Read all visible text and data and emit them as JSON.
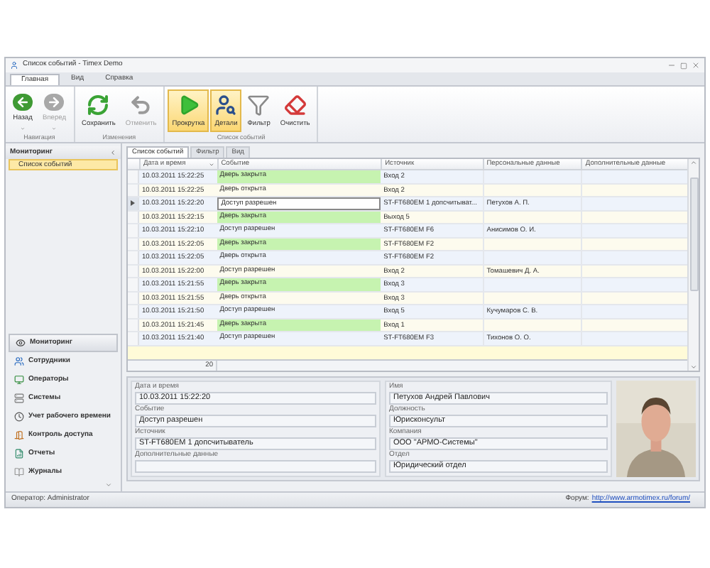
{
  "window": {
    "title": "Список событий - Timex Demo"
  },
  "ribbon_tabs": [
    {
      "label": "Главная",
      "selected": true
    },
    {
      "label": "Вид",
      "selected": false
    },
    {
      "label": "Справка",
      "selected": false
    }
  ],
  "ribbon_groups": [
    {
      "label": "Навигация",
      "buttons": [
        {
          "kind": "back",
          "label": "Назад",
          "disabled": false,
          "active": false,
          "dropdown": true
        },
        {
          "kind": "forward",
          "label": "Вперед",
          "disabled": true,
          "active": false,
          "dropdown": true
        }
      ]
    },
    {
      "label": "Изменения",
      "buttons": [
        {
          "kind": "save",
          "label": "Сохранить",
          "disabled": false,
          "active": false,
          "dropdown": false
        },
        {
          "kind": "undo",
          "label": "Отменить",
          "disabled": true,
          "active": false,
          "dropdown": false
        }
      ]
    },
    {
      "label": "Список событий",
      "buttons": [
        {
          "kind": "scroll",
          "label": "Прокрутка",
          "disabled": false,
          "active": true,
          "dropdown": false
        },
        {
          "kind": "details",
          "label": "Детали",
          "disabled": false,
          "active": true,
          "dropdown": false
        },
        {
          "kind": "filter",
          "label": "Фильтр",
          "disabled": false,
          "active": false,
          "dropdown": false
        },
        {
          "kind": "clear",
          "label": "Очистить",
          "disabled": false,
          "active": false,
          "dropdown": false
        }
      ]
    }
  ],
  "sidebar": {
    "title": "Мониторинг",
    "items": [
      {
        "label": "Список событий",
        "selected": true
      }
    ],
    "nav": [
      {
        "kind": "monitoring",
        "label": "Мониторинг",
        "selected": true
      },
      {
        "kind": "employees",
        "label": "Сотрудники",
        "selected": false
      },
      {
        "kind": "operators",
        "label": "Операторы",
        "selected": false
      },
      {
        "kind": "systems",
        "label": "Системы",
        "selected": false
      },
      {
        "kind": "time",
        "label": "Учет рабочего времени",
        "selected": false
      },
      {
        "kind": "access",
        "label": "Контроль доступа",
        "selected": false
      },
      {
        "kind": "reports",
        "label": "Отчеты",
        "selected": false
      },
      {
        "kind": "journals",
        "label": "Журналы",
        "selected": false
      }
    ]
  },
  "content_tabs": [
    {
      "label": "Список событий",
      "selected": true
    },
    {
      "label": "Фильтр",
      "selected": false
    },
    {
      "label": "Вид",
      "selected": false
    }
  ],
  "table": {
    "columns": [
      "Дата и время",
      "Событие",
      "Источник",
      "Персональные данные",
      "Дополнительные данные"
    ],
    "rows": [
      {
        "date": "10.03.2011 15:22:25",
        "event": "Дверь закрыта",
        "source": "Вход 2",
        "highlight": true,
        "selected": false
      },
      {
        "date": "10.03.2011 15:22:25",
        "event": "Дверь открыта",
        "source": "Вход 2",
        "highlight": false,
        "selected": false
      },
      {
        "date": "10.03.2011 15:22:20",
        "event": "Доступ разрешен",
        "source": "ST-FT680EM 1 допсчитыват...",
        "person": "Петухов А. П.",
        "highlight": false,
        "selected": true
      },
      {
        "date": "10.03.2011 15:22:15",
        "event": "Дверь закрыта",
        "source": "Выход 5",
        "highlight": true,
        "selected": false
      },
      {
        "date": "10.03.2011 15:22:10",
        "event": "Доступ разрешен",
        "source": "ST-FT680EM F6",
        "person": "Анисимов О. И.",
        "highlight": false,
        "selected": false
      },
      {
        "date": "10.03.2011 15:22:05",
        "event": "Дверь закрыта",
        "source": "ST-FT680EM F2",
        "highlight": true,
        "selected": false
      },
      {
        "date": "10.03.2011 15:22:05",
        "event": "Дверь открыта",
        "source": "ST-FT680EM F2",
        "highlight": false,
        "selected": false
      },
      {
        "date": "10.03.2011 15:22:00",
        "event": "Доступ разрешен",
        "source": "Вход 2",
        "person": "Томашевич Д. А.",
        "highlight": false,
        "selected": false
      },
      {
        "date": "10.03.2011 15:21:55",
        "event": "Дверь закрыта",
        "source": "Вход 3",
        "highlight": true,
        "selected": false
      },
      {
        "date": "10.03.2011 15:21:55",
        "event": "Дверь открыта",
        "source": "Вход 3",
        "highlight": false,
        "selected": false
      },
      {
        "date": "10.03.2011 15:21:50",
        "event": "Доступ разрешен",
        "source": "Вход 5",
        "person": "Кучумаров С. В.",
        "highlight": false,
        "selected": false
      },
      {
        "date": "10.03.2011 15:21:45",
        "event": "Дверь закрыта",
        "source": "Вход 1",
        "highlight": true,
        "selected": false
      },
      {
        "date": "10.03.2011 15:21:40",
        "event": "Доступ разрешен",
        "source": "ST-FT680EM F3",
        "person": "Тихонов О. О.",
        "highlight": false,
        "selected": false
      }
    ],
    "footer_count": "20"
  },
  "details": {
    "left": [
      {
        "label": "Дата и время",
        "value": "10.03.2011 15:22:20"
      },
      {
        "label": "Событие",
        "value": "Доступ разрешен"
      },
      {
        "label": "Источник",
        "value": "ST-FT680EM 1 допсчитыватель"
      },
      {
        "label": "Дополнительные данные"
      }
    ],
    "right": [
      {
        "label": "Имя",
        "value": "Петухов Андрей Павлович"
      },
      {
        "label": "Должность",
        "value": "Юрисконсульт"
      },
      {
        "label": "Компания",
        "value": "ООО \"АРМО-Системы\""
      },
      {
        "label": "Отдел",
        "value": "Юридический отдел"
      }
    ]
  },
  "status_bar": {
    "operator": "Оператор: Administrator",
    "forum_label": "Форум:",
    "forum_link": "http://www.armotimex.ru/forum/"
  }
}
